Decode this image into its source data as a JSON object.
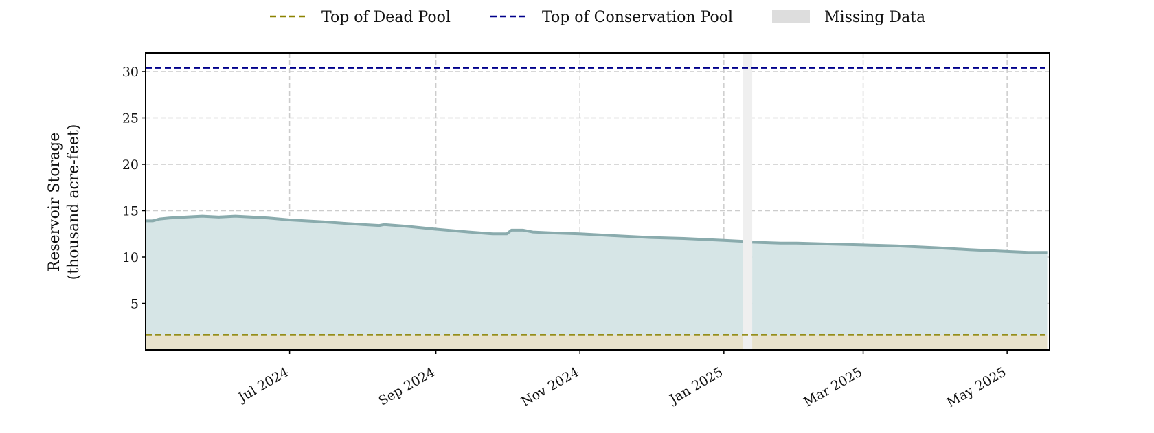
{
  "chart_data": {
    "type": "area",
    "ylabel_lines": [
      "Reservoir Storage",
      "(thousand acre-feet)"
    ],
    "xlabel": "",
    "xlim": [
      "2024-05-01",
      "2025-05-19"
    ],
    "ylim": [
      0,
      32
    ],
    "yticks": [
      5,
      10,
      15,
      20,
      25,
      30
    ],
    "xticks": [
      {
        "date": "2024-07-01",
        "label": "Jul 2024"
      },
      {
        "date": "2024-09-01",
        "label": "Sep 2024"
      },
      {
        "date": "2024-11-01",
        "label": "Nov 2024"
      },
      {
        "date": "2025-01-01",
        "label": "Jan 2025"
      },
      {
        "date": "2025-03-01",
        "label": "Mar 2025"
      },
      {
        "date": "2025-05-01",
        "label": "May 2025"
      }
    ],
    "grid": true,
    "legend_position": "top-center",
    "legend": [
      {
        "label": "Top of Dead Pool",
        "style": "dashed-line",
        "color": "#8c8200"
      },
      {
        "label": "Top of Conservation Pool",
        "style": "dashed-line",
        "color": "#00008b"
      },
      {
        "label": "Missing Data",
        "style": "patch",
        "color": "#dddddd"
      }
    ],
    "reference_lines": [
      {
        "name": "Top of Dead Pool",
        "y": 1.6,
        "color": "#8c8200"
      },
      {
        "name": "Top of Conservation Pool",
        "y": 30.4,
        "color": "#00008b"
      }
    ],
    "missing_data": [
      {
        "start": "2025-01-09",
        "end": "2025-01-13"
      }
    ],
    "series": [
      {
        "name": "Reservoir Storage",
        "color": "#8aabad",
        "fill": "#d6e5e6",
        "dead_pool_fill": "#e8e2cc",
        "segments": [
          [
            [
              "2024-05-01",
              13.9
            ],
            [
              "2024-05-04",
              13.9
            ],
            [
              "2024-05-07",
              14.1
            ],
            [
              "2024-05-11",
              14.2
            ],
            [
              "2024-05-18",
              14.3
            ],
            [
              "2024-05-25",
              14.4
            ],
            [
              "2024-06-01",
              14.3
            ],
            [
              "2024-06-08",
              14.4
            ],
            [
              "2024-06-15",
              14.3
            ],
            [
              "2024-06-22",
              14.2
            ],
            [
              "2024-07-01",
              14.0
            ],
            [
              "2024-07-15",
              13.8
            ],
            [
              "2024-08-01",
              13.5
            ],
            [
              "2024-08-08",
              13.4
            ],
            [
              "2024-08-10",
              13.5
            ],
            [
              "2024-08-20",
              13.3
            ],
            [
              "2024-09-01",
              13.0
            ],
            [
              "2024-09-15",
              12.7
            ],
            [
              "2024-09-25",
              12.5
            ],
            [
              "2024-10-01",
              12.5
            ],
            [
              "2024-10-03",
              12.9
            ],
            [
              "2024-10-08",
              12.9
            ],
            [
              "2024-10-12",
              12.7
            ],
            [
              "2024-10-20",
              12.6
            ],
            [
              "2024-11-01",
              12.5
            ],
            [
              "2024-11-15",
              12.3
            ],
            [
              "2024-12-01",
              12.1
            ],
            [
              "2024-12-15",
              12.0
            ],
            [
              "2025-01-01",
              11.8
            ],
            [
              "2025-01-09",
              11.7
            ]
          ],
          [
            [
              "2025-01-13",
              11.6
            ],
            [
              "2025-01-25",
              11.5
            ],
            [
              "2025-02-01",
              11.5
            ],
            [
              "2025-02-15",
              11.4
            ],
            [
              "2025-03-01",
              11.3
            ],
            [
              "2025-03-15",
              11.2
            ],
            [
              "2025-04-01",
              11.0
            ],
            [
              "2025-04-15",
              10.8
            ],
            [
              "2025-05-01",
              10.6
            ],
            [
              "2025-05-10",
              10.5
            ],
            [
              "2025-05-18",
              10.5
            ]
          ]
        ]
      }
    ]
  }
}
